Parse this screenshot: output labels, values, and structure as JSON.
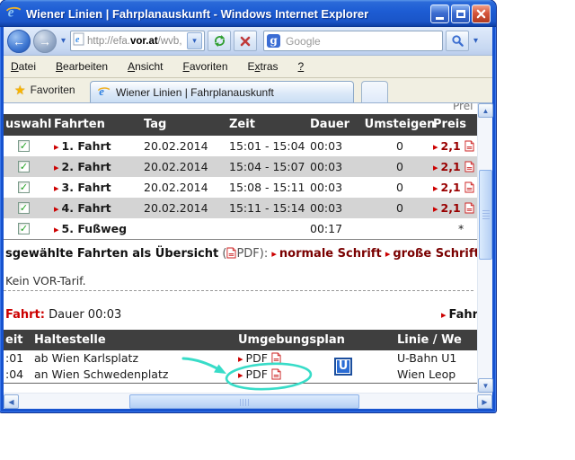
{
  "window": {
    "title": "Wiener Linien | Fahrplanauskunft - Windows Internet Explorer"
  },
  "toolbar": {
    "address_url_prefix": "http://efa.",
    "address_url_host": "vor.at",
    "address_url_suffix": "/wvb,",
    "search_placeholder": "Google"
  },
  "menu": {
    "items": [
      {
        "pre": "",
        "key": "D",
        "rest": "atei"
      },
      {
        "pre": "",
        "key": "B",
        "rest": "earbeiten"
      },
      {
        "pre": "",
        "key": "A",
        "rest": "nsicht"
      },
      {
        "pre": "",
        "key": "F",
        "rest": "avoriten"
      },
      {
        "pre": "E",
        "key": "x",
        "rest": "tras"
      },
      {
        "pre": "",
        "key": "?",
        "rest": ""
      }
    ]
  },
  "favorites_bar": {
    "label": "Favoriten",
    "tab_title": "Wiener Linien | Fahrplanauskunft"
  },
  "page": {
    "top_partial": "Prei",
    "trips_table": {
      "headers": {
        "auswahl": "uswahl",
        "fahrten": "Fahrten",
        "tag": "Tag",
        "zeit": "Zeit",
        "dauer": "Dauer",
        "umsteigen": "Umsteigen",
        "preis": "Preis"
      },
      "rows": [
        {
          "name": "1. Fahrt",
          "tag": "20.02.2014",
          "zeit": "15:01 - 15:04",
          "dauer": "00:03",
          "umsteigen": "0",
          "preis": "2,1"
        },
        {
          "name": "2. Fahrt",
          "tag": "20.02.2014",
          "zeit": "15:04 - 15:07",
          "dauer": "00:03",
          "umsteigen": "0",
          "preis": "2,1"
        },
        {
          "name": "3. Fahrt",
          "tag": "20.02.2014",
          "zeit": "15:08 - 15:11",
          "dauer": "00:03",
          "umsteigen": "0",
          "preis": "2,1"
        },
        {
          "name": "4. Fahrt",
          "tag": "20.02.2014",
          "zeit": "15:11 - 15:14",
          "dauer": "00:03",
          "umsteigen": "0",
          "preis": "2,1"
        },
        {
          "name": "5. Fußweg",
          "tag": "",
          "zeit": "",
          "dauer": "00:17",
          "umsteigen": "",
          "preis": "*"
        }
      ]
    },
    "overview": {
      "lead": "sgewählte Fahrten als Übersicht",
      "paren": "(",
      "pdf_text": "PDF):",
      "link_normal": "normale Schrift",
      "link_large": "große Schrift"
    },
    "tariff_note": "Kein VOR-Tarif.",
    "detail_header": {
      "label": "Fahrt:",
      "text": " Dauer 00:03",
      "right_link": "Fahr"
    },
    "stops_table": {
      "headers": {
        "zeit": "eit",
        "haltestelle": "Haltestelle",
        "umgebungsplan": "Umgebungsplan",
        "linie": "Linie / We"
      },
      "rows": [
        {
          "zeit": ":01",
          "haltestelle": "ab Wien Karlsplatz",
          "pdf": "PDF",
          "linie": "U-Bahn U1"
        },
        {
          "zeit": ":04",
          "haltestelle": "an Wien Schwedenplatz",
          "pdf": "PDF",
          "linie": "Wien Leop"
        }
      ],
      "ubahn_letter": "U"
    }
  },
  "icons": {
    "star": "★",
    "chevron_down": "▾",
    "back": "←",
    "forward": "→",
    "check": "✓",
    "bullet": "▸",
    "up": "▲",
    "down": "▼",
    "left": "◀",
    "right": "▶",
    "google_g": "g"
  },
  "colors": {
    "link_red": "#990000",
    "bullet_red": "#cc0000",
    "table_header_bg": "#3f3f3f",
    "row_alt": "#d4d4d4",
    "annotation_cyan": "#38dcc8",
    "luna_blue": "#1753cf"
  }
}
